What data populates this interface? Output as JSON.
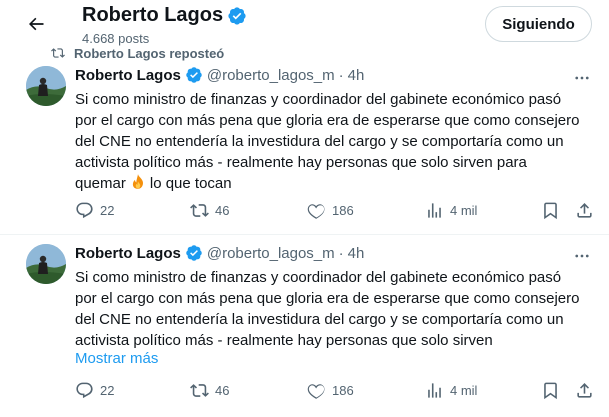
{
  "header": {
    "name": "Roberto Lagos",
    "post_count": "4.668 posts",
    "follow_label": "Siguiendo"
  },
  "repost": {
    "label": "Roberto Lagos reposteó"
  },
  "tweets": [
    {
      "name": "Roberto Lagos",
      "handle": "@roberto_lagos_m",
      "dot": "·",
      "time": "4h",
      "lines": [
        "Si como ministro de finanzas y coordinador del gabinete económico pasó",
        "por el cargo con más pena que gloria era de esperarse que como consejero",
        "del CNE no entendería la investidura del cargo y se comportaría como un",
        "activista político más - realmente hay personas que solo sirven para",
        "quemar"
      ],
      "emoji_name": "fire-emoji",
      "line5_tail": "lo que tocan",
      "replies": "22",
      "reposts": "46",
      "likes": "186",
      "views": "4 mil"
    },
    {
      "name": "Roberto Lagos",
      "handle": "@roberto_lagos_m",
      "dot": "·",
      "time": "4h",
      "lines": [
        "Si como ministro de finanzas y coordinador del gabinete económico pasó",
        "por el cargo con más pena que gloria era de esperarse que como consejero",
        "del CNE no entendería la investidura del cargo y se comportaría como un",
        "activista político más - realmente hay personas que solo sirven"
      ],
      "show_more": "Mostrar más",
      "replies": "22",
      "reposts": "46",
      "likes": "186",
      "views": "4 mil"
    }
  ],
  "colors": {
    "verified": "#1d9bf0",
    "link": "#1d9bf0",
    "secondary_text": "#536471"
  }
}
